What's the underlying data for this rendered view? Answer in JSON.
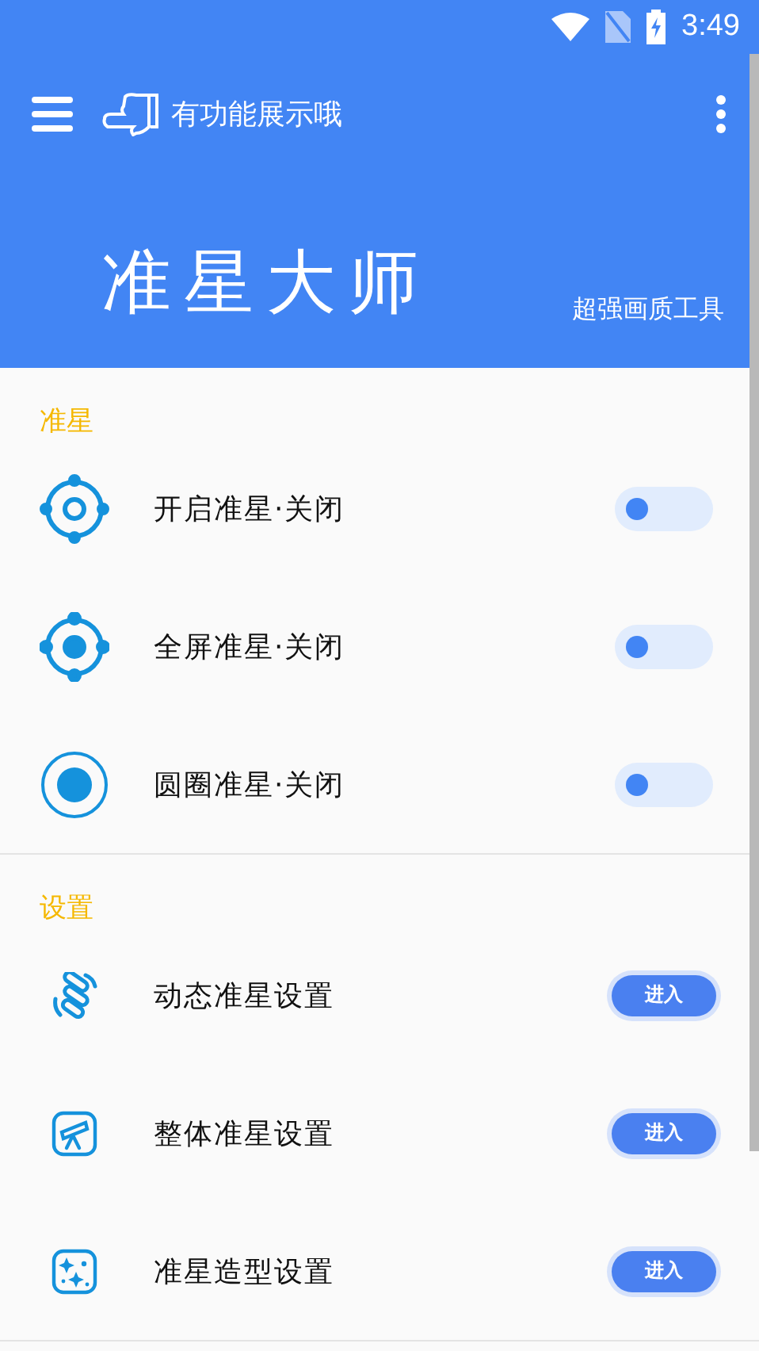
{
  "status_bar": {
    "time": "3:49"
  },
  "toolbar": {
    "title": "有功能展示哦"
  },
  "header": {
    "title": "准星大师",
    "subtitle": "超强画质工具"
  },
  "sections": [
    {
      "title": "准星",
      "items": [
        {
          "kind": "toggle",
          "label": "开启准星·关闭",
          "on": false
        },
        {
          "kind": "toggle",
          "label": "全屏准星·关闭",
          "on": false
        },
        {
          "kind": "toggle",
          "label": "圆圈准星·关闭",
          "on": false
        }
      ]
    },
    {
      "title": "设置",
      "items": [
        {
          "kind": "enter",
          "label": "动态准星设置",
          "button": "进入"
        },
        {
          "kind": "enter",
          "label": "整体准星设置",
          "button": "进入"
        },
        {
          "kind": "enter",
          "label": "准星造型设置",
          "button": "进入"
        }
      ]
    }
  ]
}
